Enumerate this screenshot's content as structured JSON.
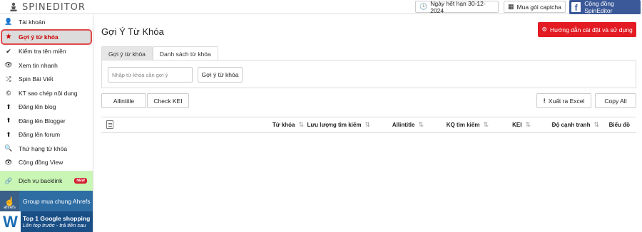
{
  "app": {
    "name": "SPINEDITOR"
  },
  "topbar": {
    "expiry_label": "Ngày hết hạn 30-12-2024",
    "captcha_label": "Mua gói captcha",
    "community_label": "Cộng đồng SpinEditor"
  },
  "sidebar": {
    "items": [
      {
        "label": "Tài khoản",
        "icon": "user-icon"
      },
      {
        "label": "Gợi ý từ khóa",
        "icon": "star-icon",
        "active": true
      },
      {
        "label": "Kiểm tra tên miền",
        "icon": "check-icon"
      },
      {
        "label": "Xem tin nhanh",
        "icon": "eye-icon"
      },
      {
        "label": "Spin Bài Viết",
        "icon": "shuffle-icon"
      },
      {
        "label": "KT sao chép nội dung",
        "icon": "copyright-icon"
      },
      {
        "label": "Đăng lên blog",
        "icon": "upload-icon"
      },
      {
        "label": "Đăng lên Blogger",
        "icon": "upload-icon"
      },
      {
        "label": "Đăng lên forum",
        "icon": "upload-icon"
      },
      {
        "label": "Thứ hạng từ khóa",
        "icon": "search-icon"
      },
      {
        "label": "Cộng đồng View",
        "icon": "eye-icon"
      }
    ],
    "backlink": {
      "label": "Dịch vụ backlink",
      "badge": "NEW"
    },
    "ahrefs": {
      "label": "Group mua chung Ahrefs",
      "logo_text": "ahrefs"
    },
    "google_shopping": {
      "line1": "Top 1 Google shopping",
      "line2": "Lên top trước - trả tiền sau"
    }
  },
  "main": {
    "title": "Gợi Ý Từ Khóa",
    "guide_button": "Hướng dẫn cài đặt và sử dụng",
    "tabs": [
      {
        "label": "Gợi ý từ khóa",
        "active": true
      },
      {
        "label": "Danh sách từ khóa",
        "active": false
      }
    ],
    "keyword_input": {
      "placeholder": "Nhập từ khóa cần gợi ý",
      "value": ""
    },
    "suggest_button": "Gợi ý từ khóa",
    "allintitle_button": "Allintitle",
    "check_kei_button": "Check KEI",
    "export_button": "Xuất ra Excel",
    "copy_all_button": "Copy All",
    "table": {
      "columns": [
        "Từ khóa",
        "Lưu lượng tìm kiếm",
        "Allintitle",
        "KQ tìm kiếm",
        "KEI",
        "Độ cạnh tranh",
        "Biểu đồ"
      ],
      "rows": []
    }
  },
  "colors": {
    "accent_red": "#e31b23",
    "facebook_blue": "#3b5998",
    "backlink_green": "#c9f5b5",
    "ahrefs_blue": "#2e6da4"
  }
}
